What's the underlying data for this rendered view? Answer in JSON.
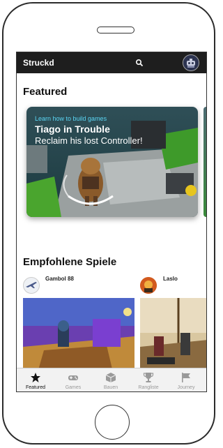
{
  "app": {
    "name": "Struckd"
  },
  "featured": {
    "title": "Featured",
    "card": {
      "kicker": "Learn how to build games",
      "title": "Tiago in Trouble",
      "subtitle": "Reclaim his lost Controller!"
    }
  },
  "recommended": {
    "title": "Empfohlene Spiele",
    "games": [
      {
        "author": "Gambol 88"
      },
      {
        "author": "Laslo"
      }
    ]
  },
  "nav": {
    "items": [
      {
        "label": "Featured",
        "icon": "star-icon",
        "active": true
      },
      {
        "label": "Games",
        "icon": "gamepad-icon",
        "active": false
      },
      {
        "label": "Bauen",
        "icon": "box-icon",
        "active": false
      },
      {
        "label": "Rangliste",
        "icon": "trophy-icon",
        "active": false
      },
      {
        "label": "Journey",
        "icon": "flag-icon",
        "active": false
      }
    ]
  },
  "colors": {
    "topbar": "#1e1e1e",
    "accent": "#5ad6f5",
    "nav_active": "#111111",
    "nav_inactive": "#999999"
  }
}
